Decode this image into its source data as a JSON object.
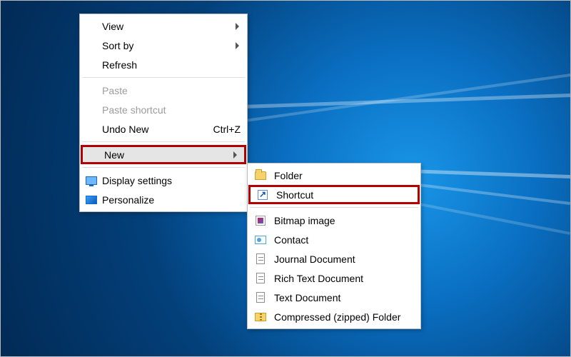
{
  "primary_menu": {
    "view": {
      "label": "View",
      "has_submenu": true
    },
    "sort": {
      "label": "Sort by",
      "has_submenu": true
    },
    "refresh": {
      "label": "Refresh"
    },
    "paste": {
      "label": "Paste"
    },
    "paste_sc": {
      "label": "Paste shortcut"
    },
    "undo": {
      "label": "Undo New",
      "accel": "Ctrl+Z"
    },
    "new": {
      "label": "New",
      "has_submenu": true,
      "highlighted": true
    },
    "display": {
      "label": "Display settings"
    },
    "personalize": {
      "label": "Personalize"
    }
  },
  "submenu_new": {
    "folder": {
      "label": "Folder"
    },
    "shortcut": {
      "label": "Shortcut"
    },
    "bitmap": {
      "label": "Bitmap image"
    },
    "contact": {
      "label": "Contact"
    },
    "journal": {
      "label": "Journal Document"
    },
    "rtf": {
      "label": "Rich Text Document"
    },
    "text": {
      "label": "Text Document"
    },
    "zip": {
      "label": "Compressed (zipped) Folder"
    }
  },
  "annotations": {
    "highlight_primary": "New",
    "highlight_submenu": "Shortcut",
    "highlight_color": "#b30000"
  }
}
